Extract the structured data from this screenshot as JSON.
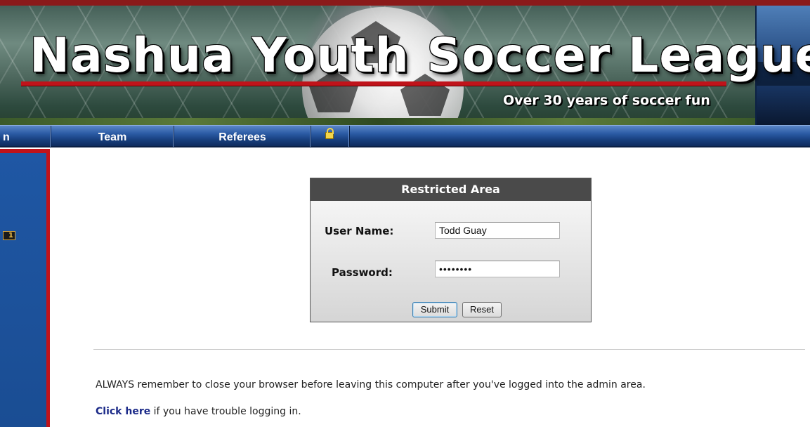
{
  "banner": {
    "title": "Nashua Youth Soccer League",
    "tagline": "Over 30 years of soccer fun"
  },
  "nav": {
    "items": [
      {
        "label": "n"
      },
      {
        "label": "Team"
      },
      {
        "label": "Referees"
      }
    ],
    "lock_icon": "lock-icon"
  },
  "sidebar": {
    "badge": "1"
  },
  "login": {
    "header": "Restricted Area",
    "username_label": "User Name:",
    "username_value": "Todd Guay",
    "password_label": "Password:",
    "password_value": "••••••••",
    "submit_label": "Submit",
    "reset_label": "Reset"
  },
  "content": {
    "warning": "ALWAYS remember to close your browser before leaving this computer after you've logged into the admin area.",
    "help_link": "Click here",
    "help_rest": " if you have trouble logging in."
  },
  "colors": {
    "nav_blue": "#2a5aa3",
    "accent_red": "#c0131a",
    "header_gray": "#4a4a4a",
    "link": "#1b2a88"
  }
}
